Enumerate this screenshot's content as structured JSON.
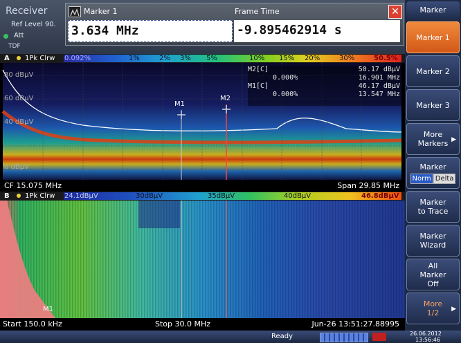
{
  "header": {
    "title": "Receiver",
    "ref_level_label": "Ref Level",
    "ref_level_value": "90.",
    "att_label": "Att",
    "tdf_label": "TDF"
  },
  "dialog": {
    "name": "Marker 1",
    "frame_time_label": "Frame Time",
    "frequency_value": "3.634 MHz",
    "time_value": "-9.895462914 s"
  },
  "sidebar": {
    "title": "Marker",
    "buttons": [
      {
        "label": "Marker 1",
        "active": true
      },
      {
        "label": "Marker 2"
      },
      {
        "label": "Marker 3"
      },
      {
        "label": "More Markers"
      },
      {
        "label": "Marker",
        "toggle": [
          "Norm",
          "Delta"
        ]
      },
      {
        "label": "Marker to Trace"
      },
      {
        "label": "Marker Wizard"
      },
      {
        "label": "All Marker Off"
      },
      {
        "label": "More 1/2"
      }
    ]
  },
  "panelA": {
    "id": "A",
    "trace": "1Pk Clrw",
    "scale": [
      "0.092%",
      "1%",
      "2%",
      "3%",
      "5%",
      "10%",
      "15%",
      "20%",
      "30%",
      "50.5%"
    ],
    "yticks": [
      "80 dBµV",
      "60 dBµV",
      "40 dBµV",
      "0 dBµV"
    ],
    "markers_table": [
      {
        "name": "M2[C]",
        "pct": "0.000%",
        "level": "50.17 dBµV",
        "freq": "16.901 MHz"
      },
      {
        "name": "M1[C]",
        "pct": "0.000%",
        "level": "46.17 dBµV",
        "freq": "13.547 MHz"
      }
    ],
    "marker_labels": [
      "M1",
      "M2"
    ],
    "cf": "CF 15.075 MHz",
    "span": "Span 29.85 MHz"
  },
  "panelB": {
    "id": "B",
    "trace": "1Pk Clrw",
    "scale": [
      "24.1dBµV",
      "30dBµV",
      "35dBµV",
      "40dBµV",
      "46.8dBµV"
    ],
    "marker_label": "M1",
    "start": "Start 150.0 kHz",
    "stop": "Stop 30.0 MHz",
    "timestamp": "Jun-26 13:51:27.88995"
  },
  "status": {
    "text": "Ready",
    "date": "26.06.2012",
    "time": "13:56:46"
  },
  "colors": {
    "accent": "#f07a30",
    "panel": "#1e2a44"
  }
}
